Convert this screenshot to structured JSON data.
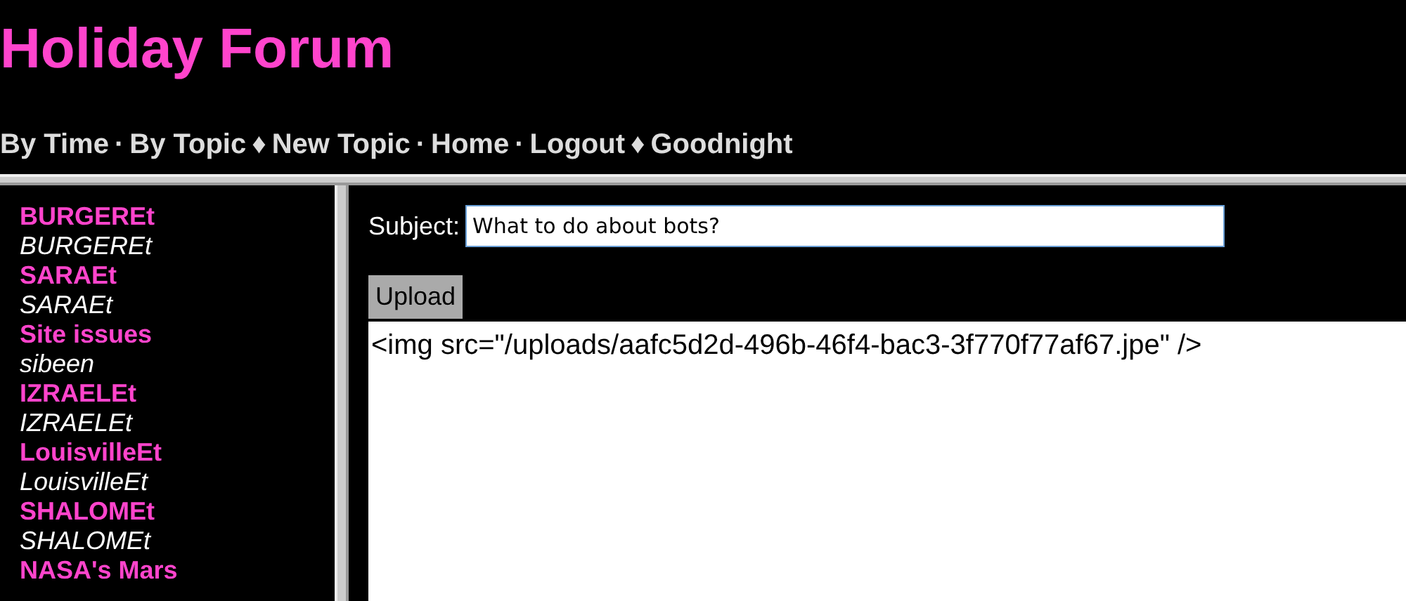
{
  "site_title": "Holiday Forum",
  "nav": [
    {
      "label": "By Time",
      "separator": "·"
    },
    {
      "label": "By Topic",
      "separator": "♦"
    },
    {
      "label": "New Topic",
      "separator": "·"
    },
    {
      "label": "Home",
      "separator": "·"
    },
    {
      "label": "Logout",
      "separator": "♦"
    },
    {
      "label": "Goodnight"
    }
  ],
  "sidebar": {
    "topics": [
      {
        "title": "BURGEREt",
        "author": "BURGEREt"
      },
      {
        "title": "SARAEt",
        "author": "SARAEt"
      },
      {
        "title": "Site issues",
        "author": "sibeen"
      },
      {
        "title": "IZRAELEt",
        "author": "IZRAELEt"
      },
      {
        "title": "LouisvilleEt",
        "author": "LouisvilleEt"
      },
      {
        "title": "SHALOMEt",
        "author": "SHALOMEt"
      },
      {
        "title": "NASA's Mars"
      }
    ]
  },
  "form": {
    "subject_label": "Subject:",
    "subject_value": "What to do about bots?",
    "upload_button": "Upload",
    "body_value": "<img src=\"/uploads/aafc5d2d-496b-46f4-bac3-3f770f77af67.jpe\" />"
  }
}
